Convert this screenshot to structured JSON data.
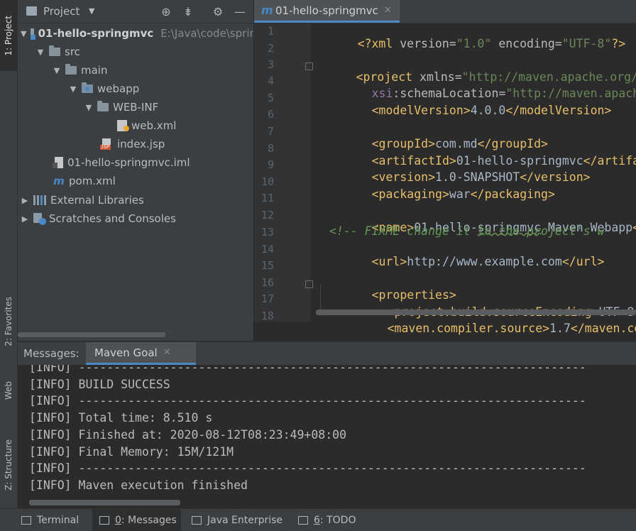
{
  "left_strip": {
    "project_tab": "1: Project",
    "favorites_tab": "2: Favorites",
    "web_tab": "Web",
    "structure_tab": "Z: Structure"
  },
  "project_panel": {
    "title": "Project",
    "tree": [
      {
        "label": "01-hello-springmvc",
        "path": "E:\\Java\\code\\sprin",
        "icon": "module-folder-icon",
        "expanded": true
      },
      {
        "label": "src",
        "icon": "folder-icon",
        "expanded": true
      },
      {
        "label": "main",
        "icon": "folder-icon",
        "expanded": true
      },
      {
        "label": "webapp",
        "icon": "web-folder-icon",
        "expanded": true
      },
      {
        "label": "WEB-INF",
        "icon": "folder-icon",
        "expanded": true
      },
      {
        "label": "web.xml",
        "icon": "xml-file-icon"
      },
      {
        "label": "index.jsp",
        "icon": "jsp-file-icon"
      },
      {
        "label": "01-hello-springmvc.iml",
        "icon": "iml-file-icon"
      },
      {
        "label": "pom.xml",
        "icon": "maven-icon"
      },
      {
        "label": "External Libraries",
        "icon": "libraries-icon",
        "expanded": false
      },
      {
        "label": "Scratches and Consoles",
        "icon": "scratches-icon",
        "expanded": false
      }
    ]
  },
  "editor": {
    "tab_label": "01-hello-springmvc",
    "line_numbers": [
      "1",
      "2",
      "3",
      "4",
      "5",
      "6",
      "7",
      "8",
      "9",
      "10",
      "11",
      "12",
      "13",
      "14",
      "15",
      "16",
      "17",
      "18"
    ],
    "lines": {
      "l1": [
        "<?xml ",
        "version",
        "=",
        "\"1.0\"",
        " ",
        "encoding",
        "=",
        "\"UTF-8\"",
        "?>"
      ],
      "l3": [
        "<project ",
        "xmlns",
        "=",
        "\"http://maven.apache.org/P"
      ],
      "l4": [
        "xsi",
        ":schemaLocation",
        "=",
        "\"http://maven.apache"
      ],
      "l5": [
        "<modelVersion>",
        "4.0.0",
        "</modelVersion>"
      ],
      "l7": [
        "<groupId>",
        "com.md",
        "</groupId>"
      ],
      "l8": [
        "<artifactId>",
        "01-hello-springmvc",
        "</artifac"
      ],
      "l9": [
        "<version>",
        "1.0-SNAPSHOT",
        "</version>"
      ],
      "l10": [
        "<packaging>",
        "war",
        "</packaging>"
      ],
      "l12": [
        "<name>",
        "01-hello-",
        "springmvc",
        " Maven Webapp",
        "</"
      ],
      "l13": "<!-- FIXME change it to the project's w",
      "l14": [
        "<url>",
        "http://www.example.com",
        "</url>"
      ],
      "l16": [
        "<properties>"
      ],
      "l17": [
        "<project.build.sourceEncoding>",
        "UTF-8",
        "</"
      ],
      "l18": [
        "<maven.compiler.source>",
        "1.7",
        "</maven.com"
      ]
    }
  },
  "messages": {
    "label": "Messages:",
    "tab_label": "Maven Goal",
    "output": [
      "[INFO] ------------------------------------------------------------------------",
      "[INFO] BUILD SUCCESS",
      "[INFO] ------------------------------------------------------------------------",
      "[INFO] Total time: 8.510 s",
      "[INFO] Finished at: 2020-08-12T08:23:49+08:00",
      "[INFO] Final Memory: 15M/121M",
      "[INFO] ------------------------------------------------------------------------",
      "[INFO] Maven execution finished"
    ]
  },
  "bottom_bar": {
    "terminal": "Terminal",
    "messages_key": "0",
    "messages_rest": ": Messages",
    "java_enterprise": "Java Enterprise",
    "todo_key": "6",
    "todo_rest": ": TODO"
  },
  "colors": {
    "background": "#2b2b2b",
    "panel": "#3c3f41",
    "accent": "#4a88c7",
    "xml_tag": "#e8bf6a",
    "xml_string": "#6a8759",
    "comment": "#629755"
  }
}
